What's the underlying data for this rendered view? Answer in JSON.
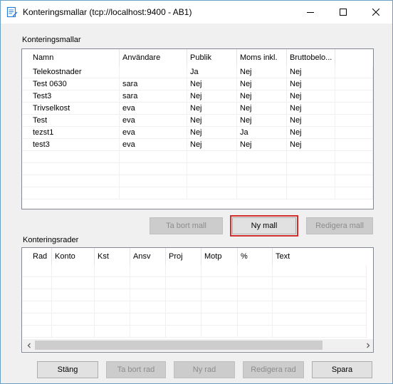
{
  "window": {
    "title": "Konteringsmallar (tcp://localhost:9400 - AB1)",
    "accent": "#2a7fd4"
  },
  "titlebar_icons": {
    "app": "document-edit-icon",
    "minimize": "minimize-icon",
    "maximize": "maximize-icon",
    "close": "close-icon"
  },
  "templates_group": {
    "label": "Konteringsmallar",
    "columns": [
      "Namn",
      "Användare",
      "Publik",
      "Moms inkl.",
      "Bruttobelo..."
    ],
    "rows": [
      [
        "Telekostnader",
        "",
        "Ja",
        "Nej",
        "Nej"
      ],
      [
        "Test 0630",
        "sara",
        "Nej",
        "Nej",
        "Nej"
      ],
      [
        "Test3",
        "sara",
        "Nej",
        "Nej",
        "Nej"
      ],
      [
        "Trivselkost",
        "eva",
        "Nej",
        "Nej",
        "Nej"
      ],
      [
        "Test",
        "eva",
        "Nej",
        "Nej",
        "Nej"
      ],
      [
        "tezst1",
        "eva",
        "Nej",
        "Ja",
        "Nej"
      ],
      [
        "test3",
        "eva",
        "Nej",
        "Nej",
        "Nej"
      ]
    ],
    "buttons": {
      "remove": "Ta bort mall",
      "new": "Ny mall",
      "edit": "Redigera mall"
    }
  },
  "rows_group": {
    "label": "Konteringsrader",
    "columns": [
      "Rad",
      "Konto",
      "Kst",
      "Ansv",
      "Proj",
      "Motp",
      "%",
      "Text"
    ]
  },
  "bottom_buttons": {
    "close": "Stäng",
    "remove_row": "Ta bort rad",
    "new_row": "Ny rad",
    "edit_row": "Redigera rad",
    "save": "Spara"
  },
  "highlight_color": "#d32f2f"
}
